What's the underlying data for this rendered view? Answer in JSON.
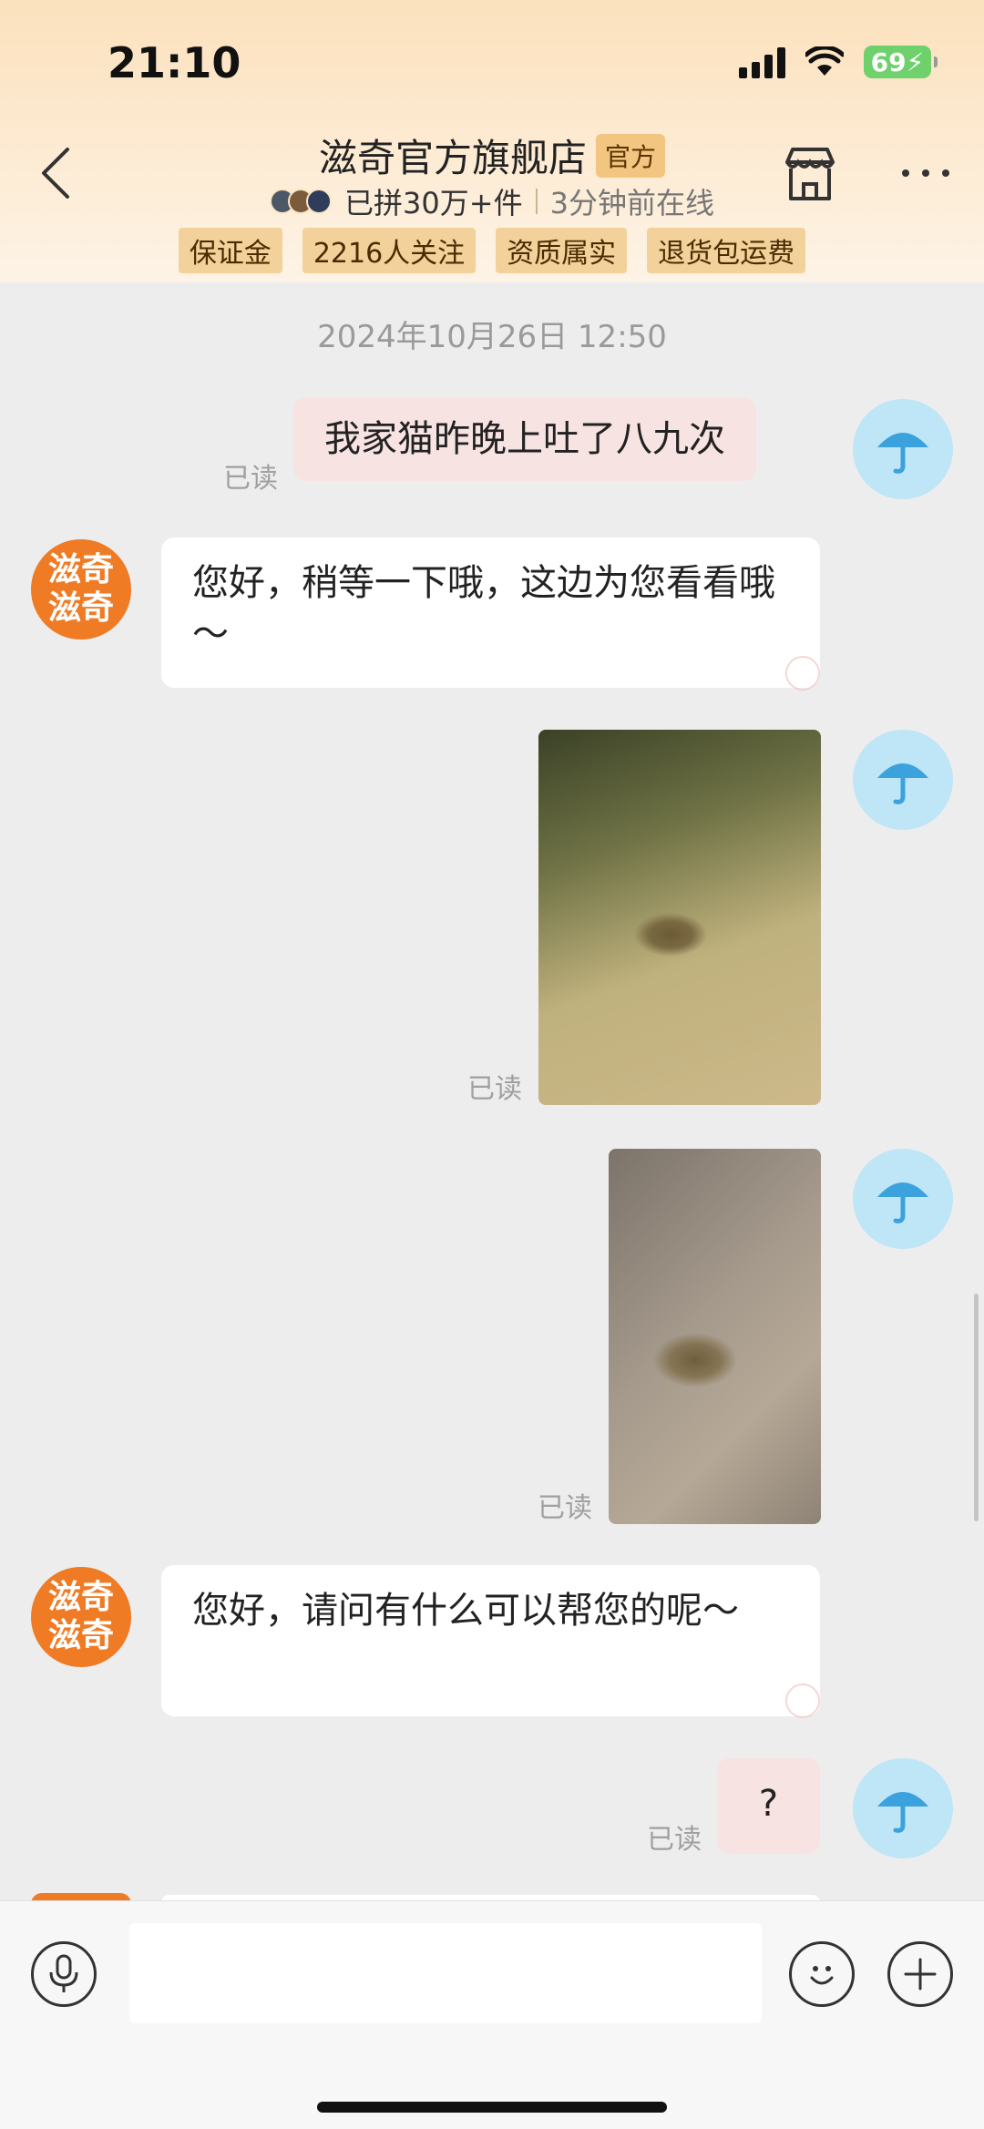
{
  "status_bar": {
    "time": "21:10",
    "battery": "69"
  },
  "header": {
    "store_name": "滋奇官方旗舰店",
    "official_badge": "官方",
    "sales": "已拼30万+件",
    "online_status": "3分钟前在线",
    "tags": [
      "保证金",
      "2216人关注",
      "资质属实",
      "退货包运费"
    ]
  },
  "chat": {
    "timestamp": "2024年10月26日 12:50",
    "read_label": "已读",
    "shop_avatar_line1": "滋奇",
    "shop_avatar_line2": "滋奇",
    "messages": [
      {
        "text": "我家猫昨晚上吐了八九次"
      },
      {
        "text": "您好，稍等一下哦，这边为您看看哦～"
      },
      {
        "text": ""
      },
      {
        "text": ""
      },
      {
        "text": "您好，请问有什么可以帮您的呢～"
      },
      {
        "text": "?"
      }
    ]
  },
  "input": {
    "placeholder": ""
  },
  "colors": {
    "header_bg": "#fbe1bd",
    "shop_avatar": "#ef7b25",
    "user_avatar": "#bfe6f6",
    "my_bubble": "#f7e3e1",
    "tag_bg": "#f3d19b"
  },
  "icons": [
    "back-icon",
    "store-icon",
    "more-icon",
    "umbrella-icon",
    "mic-icon",
    "emoji-icon",
    "plus-icon"
  ]
}
